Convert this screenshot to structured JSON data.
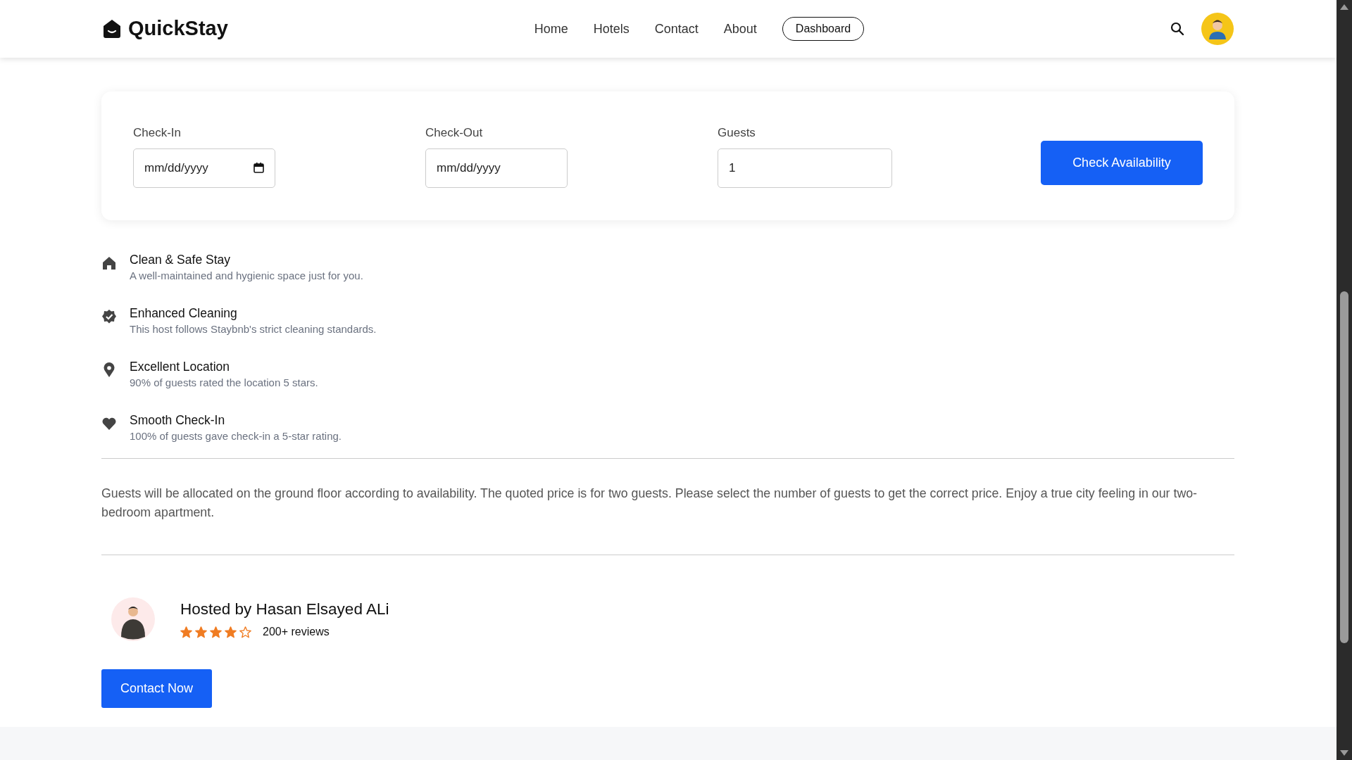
{
  "navbar": {
    "brand": "QuickStay",
    "links": [
      "Home",
      "Hotels",
      "Contact",
      "About"
    ],
    "dashboard_button": "Dashboard"
  },
  "booking_form": {
    "fields": [
      {
        "label": "Check-In",
        "kind": "date",
        "value": "mm/dd/yyyy",
        "calendar_icon": true
      },
      {
        "label": "Check-Out",
        "kind": "date",
        "value": "mm/dd/yyyy",
        "calendar_icon": false
      },
      {
        "label": "Guests",
        "kind": "number",
        "value": "1",
        "calendar_icon": false
      }
    ],
    "button": "Check Availability"
  },
  "features": [
    {
      "kind": "home",
      "title": "Clean & Safe Stay",
      "description": "A well-maintained and hygienic space just for you."
    },
    {
      "kind": "badge",
      "title": "Enhanced Cleaning",
      "description": "This host follows Staybnb's strict cleaning standards."
    },
    {
      "kind": "pin",
      "title": "Excellent Location",
      "description": "90% of guests rated the location 5 stars."
    },
    {
      "kind": "heart",
      "title": "Smooth Check-In",
      "description": "100% of guests gave check-in a 5-star rating."
    }
  ],
  "description": "Guests will be allocated on the ground floor according to availability. The quoted price is for two guests. Please select the number of guests to get the correct price. Enjoy a true city feeling in our two-bedroom apartment.",
  "host": {
    "name": "Hosted by Hasan Elsayed ALi",
    "stars": 4,
    "reviews": "200+ reviews",
    "contact_button": "Contact Now"
  }
}
